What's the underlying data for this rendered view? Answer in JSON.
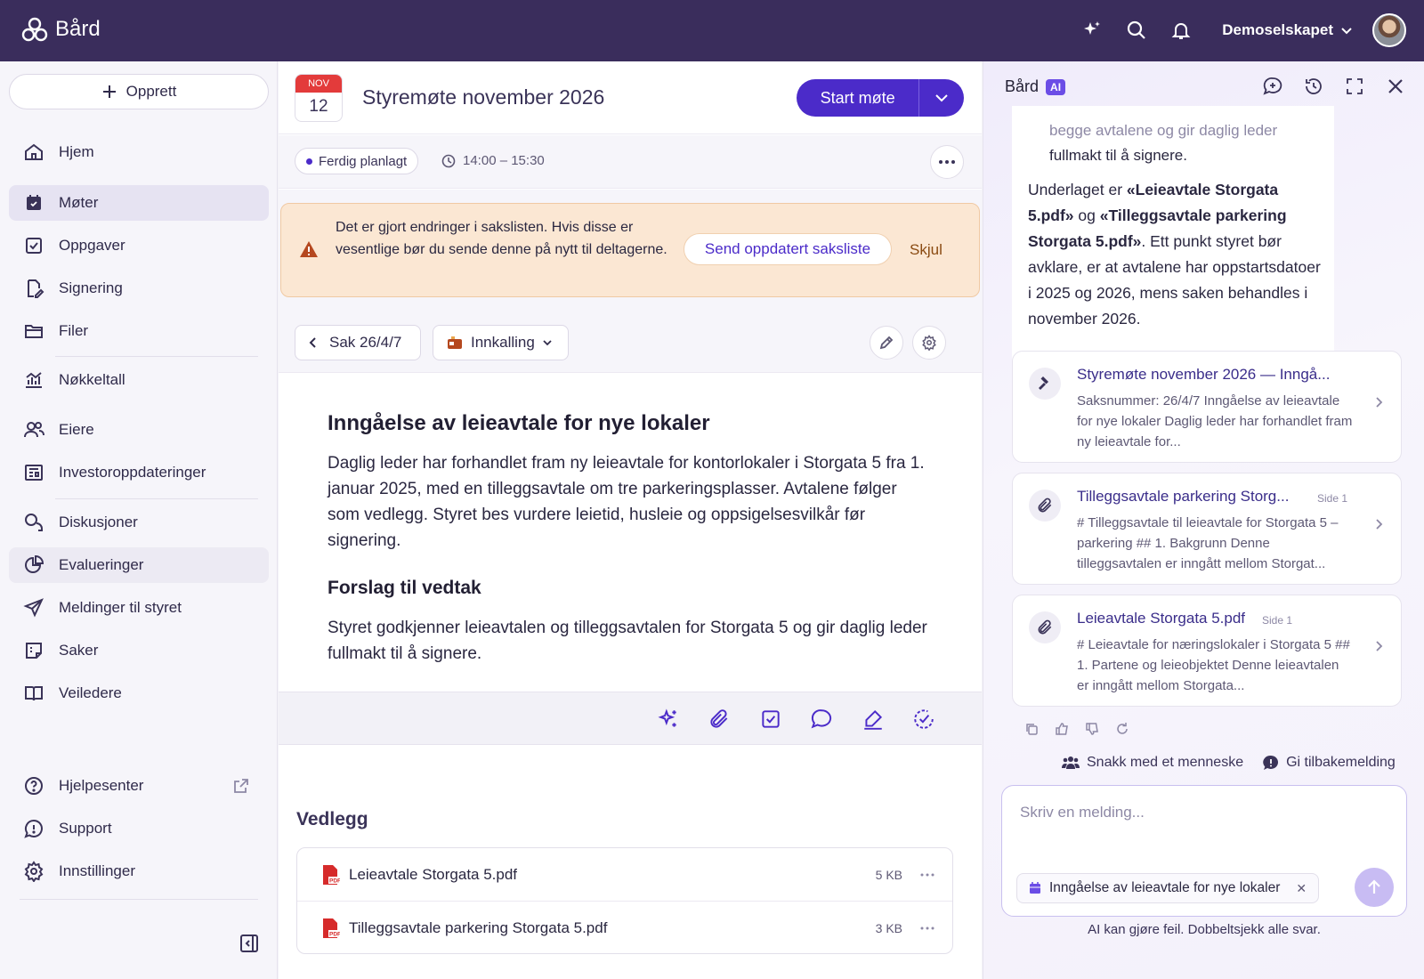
{
  "app": {
    "name": "Bård"
  },
  "topbar": {
    "company": "Demoselskapet"
  },
  "sidebar": {
    "create_label": "Opprett",
    "items": [
      {
        "label": "Hjem"
      },
      {
        "label": "Møter"
      },
      {
        "label": "Oppgaver"
      },
      {
        "label": "Signering"
      },
      {
        "label": "Filer"
      },
      {
        "label": "Nøkkeltall"
      },
      {
        "label": "Eiere"
      },
      {
        "label": "Investoroppdateringer"
      },
      {
        "label": "Diskusjoner"
      },
      {
        "label": "Evalueringer"
      },
      {
        "label": "Meldinger til styret"
      },
      {
        "label": "Saker"
      },
      {
        "label": "Veiledere"
      }
    ],
    "bottom_items": [
      {
        "label": "Hjelpesenter"
      },
      {
        "label": "Support"
      },
      {
        "label": "Innstillinger"
      }
    ]
  },
  "meeting": {
    "month": "NOV",
    "day": "12",
    "title": "Styremøte november 2026",
    "start_label": "Start møte",
    "status": "Ferdig planlagt",
    "time": "14:00 – 15:30"
  },
  "warning": {
    "text": "Det er gjort endringer i sakslisten. Hvis disse er vesentlige bør du sende denne på nytt til deltagerne.",
    "send_label": "Send oppdatert saksliste",
    "hide_label": "Skjul"
  },
  "toolbar": {
    "sak_label": "Sak 26/4/7",
    "innkalling_label": "Innkalling"
  },
  "agenda_item": {
    "title": "Inngåelse av leieavtale for nye lokaler",
    "body": "Daglig leder har forhandlet fram ny leieavtale for kontorlokaler i Storgata 5 fra 1. januar 2025, med en tilleggsavtale om tre parkeringsplasser. Avtalene følger som vedlegg. Styret bes vurdere leietid, husleie og oppsigelsesvilkår før signering.",
    "proposal_heading": "Forslag til vedtak",
    "proposal": "Styret godkjenner leieavtalen og tilleggsavtalen for Storgata 5 og gir daglig leder fullmakt til å signere."
  },
  "attachments": {
    "heading": "Vedlegg",
    "files": [
      {
        "name": "Leieavtale Storgata 5.pdf",
        "size": "5 KB"
      },
      {
        "name": "Tilleggsavtale parkering Storgata 5.pdf",
        "size": "3 KB"
      }
    ]
  },
  "ai": {
    "title": "Bård",
    "badge": "AI",
    "faded_line": "begge avtalene og gir daglig leder",
    "visible_line": "fullmakt til å signere.",
    "answer_pre": "Underlaget er ",
    "answer_doc1": "«Leieavtale Storgata 5.pdf»",
    "answer_mid": " og ",
    "answer_doc2": "«Tilleggsavtale parkering Storgata 5.pdf»",
    "answer_post": ". Ett punkt styret bør avklare, er at avtalene har oppstartsdatoer i 2025 og 2026, mens saken behandles i november 2026.",
    "sources": [
      {
        "title": "Styremøte november 2026 — Inngå...",
        "page": "",
        "text": "Saksnummer: 26/4/7 Inngåelse av leieavtale for nye lokaler Daglig leder har forhandlet fram ny leieavtale for..."
      },
      {
        "title": "Tilleggsavtale parkering Storg...",
        "page": "Side 1",
        "text": "# Tilleggsavtale til leieavtale for Storgata 5 – parkering ## 1. Bakgrunn Denne tilleggsavtalen er inngått mellom Storgat..."
      },
      {
        "title": "Leieavtale Storgata 5.pdf",
        "page": "Side 1",
        "text": "# Leieavtale for næringslokaler i Storgata 5 ## 1. Partene og leieobjektet Denne leieavtalen er inngått mellom Storgata..."
      }
    ],
    "human_label": "Snakk med et menneske",
    "feedback_label": "Gi tilbakemelding",
    "input_placeholder": "Skriv en melding...",
    "context_chip": "Inngåelse av leieavtale for nye lokaler",
    "disclaimer": "AI kan gjøre feil. Dobbeltsjekk alle svar."
  },
  "colors": {
    "topbar": "#3a2d5c",
    "accent": "#4b2bc9",
    "warning_bg": "#fbe7d3"
  }
}
